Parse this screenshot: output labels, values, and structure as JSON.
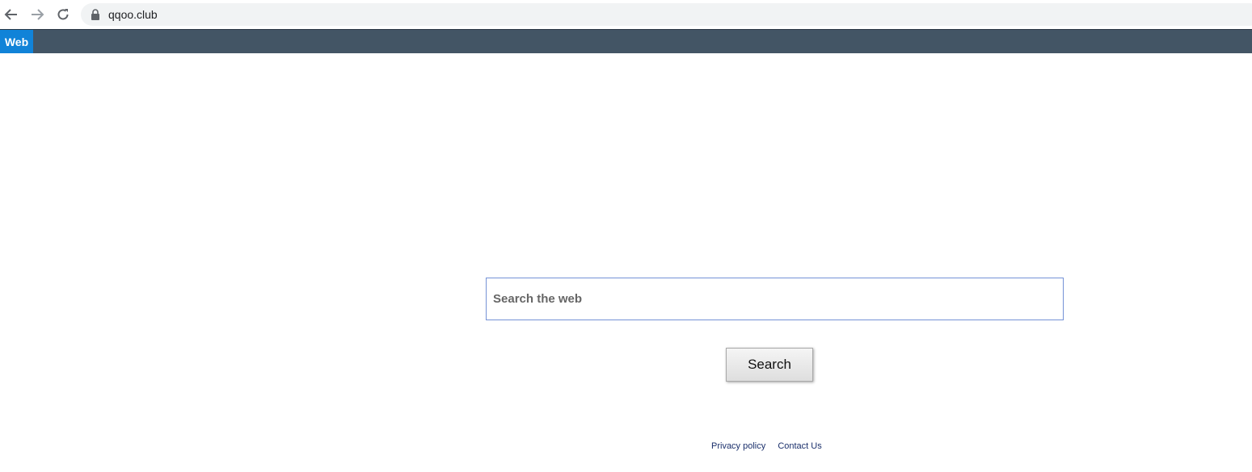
{
  "browser": {
    "url": "qqoo.club",
    "icons": {
      "back": "arrow-left-icon",
      "forward": "arrow-right-icon",
      "reload": "reload-icon",
      "lock": "lock-icon"
    }
  },
  "site_nav": {
    "tabs": [
      {
        "label": "Web",
        "active": true
      }
    ]
  },
  "search": {
    "placeholder": "Search the web",
    "button_label": "Search"
  },
  "footer": {
    "links": [
      "Privacy policy",
      "Contact Us"
    ]
  },
  "colors": {
    "nav_bar": "#435565",
    "active_tab": "#1183d8",
    "input_border": "#7592d6",
    "footer_link": "#1a2f6b"
  }
}
